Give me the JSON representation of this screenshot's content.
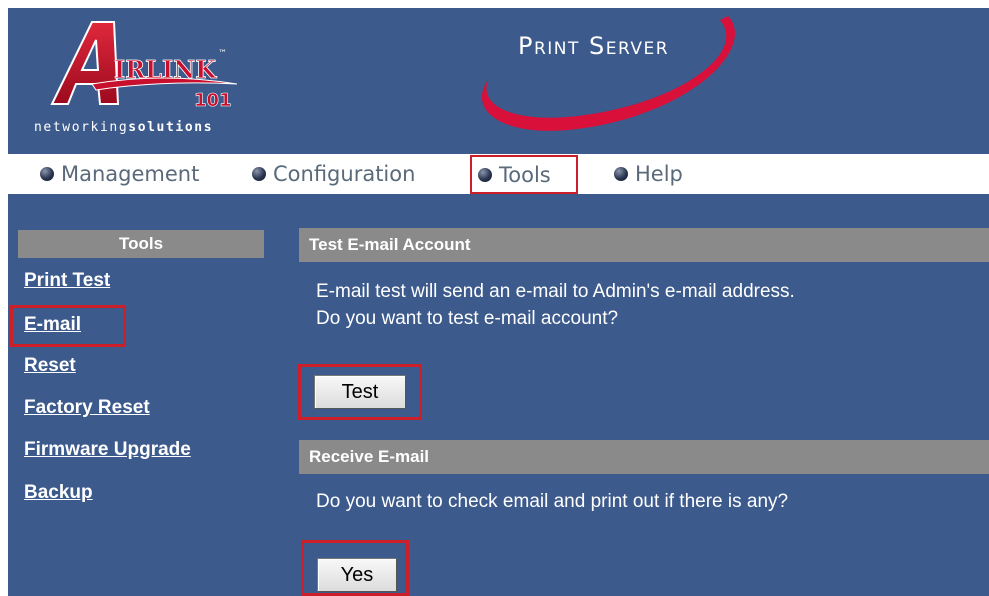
{
  "brand": {
    "logo_letter": "A",
    "logo_word": "IRLINK",
    "logo_tm": "™",
    "logo_number": "101",
    "tagline_prefix": "networking",
    "tagline_suffix": "solutions",
    "product_title": "Print Server",
    "colors": {
      "background": "#3c5a8c",
      "logo_red": "#c8102e",
      "highlight_red": "#cc1f2a"
    }
  },
  "nav": {
    "items": [
      {
        "label": "Management",
        "icon": "sphere-bullet-icon"
      },
      {
        "label": "Configuration",
        "icon": "sphere-bullet-icon"
      },
      {
        "label": "Tools",
        "icon": "sphere-bullet-icon",
        "highlighted": true
      },
      {
        "label": "Help",
        "icon": "sphere-bullet-icon"
      }
    ]
  },
  "sidebar": {
    "title": "Tools",
    "items": [
      {
        "label": "Print Test"
      },
      {
        "label": "E-mail",
        "highlighted": true
      },
      {
        "label": "Reset"
      },
      {
        "label": "Factory Reset"
      },
      {
        "label": "Firmware Upgrade"
      },
      {
        "label": "Backup"
      }
    ]
  },
  "main": {
    "test_section": {
      "title": "Test E-mail Account",
      "line1": "E-mail test will send an e-mail to Admin's e-mail address.",
      "line2": "Do you want to test e-mail account?",
      "button": "Test"
    },
    "receive_section": {
      "title": "Receive E-mail",
      "line1": "Do you want to check email and print out if there is any?",
      "button": "Yes"
    }
  }
}
